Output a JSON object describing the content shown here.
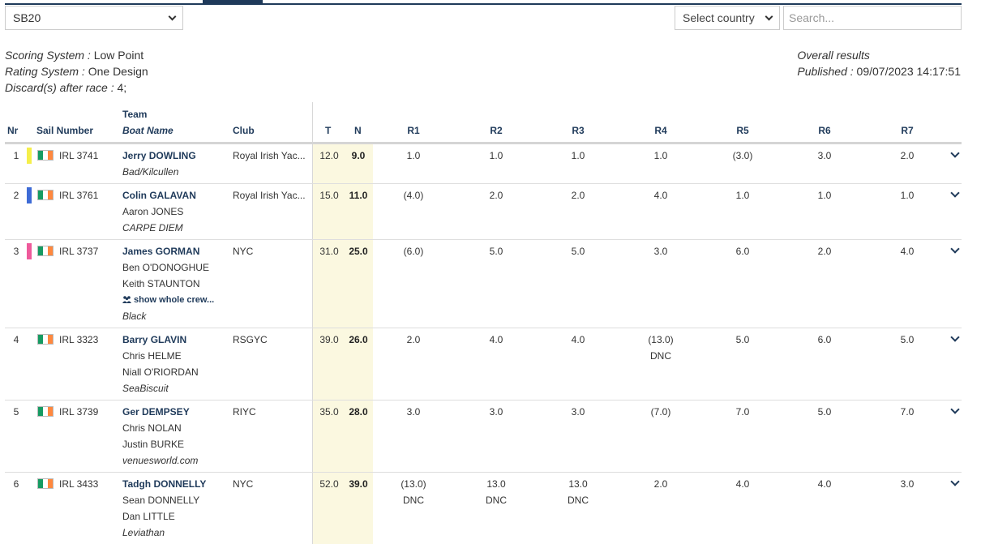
{
  "filters": {
    "class_value": "SB20",
    "country_value": "Select country",
    "search_placeholder": "Search..."
  },
  "meta": {
    "scoring_label": "Scoring System :",
    "scoring_value": " Low Point",
    "rating_label": "Rating System :",
    "rating_value": " One Design",
    "discard_label": "Discard(s) after race :",
    "discard_value": " 4;",
    "results_title": "Overall results",
    "published_label": "Published :",
    "published_value": " 09/07/2023 14:17:51"
  },
  "headers": {
    "nr": "Nr",
    "sail": "Sail Number",
    "team": "Team",
    "boat": "Boat Name",
    "club": "Club",
    "t": "T",
    "n": "N",
    "races": [
      "R1",
      "R2",
      "R3",
      "R4",
      "R5",
      "R6",
      "R7"
    ]
  },
  "colors": {
    "navy": "#1f3a5a",
    "highlight": "#fbf8e0",
    "flag_green": "#169b62",
    "flag_white": "#ffffff",
    "flag_orange": "#ff883e"
  },
  "rows": [
    {
      "nr": "1",
      "tag_color": "#f5ef4a",
      "flag_icon": "ireland-flag-icon",
      "sail": "IRL 3741",
      "skipper": "Jerry DOWLING",
      "crew": [],
      "show_crew": "",
      "boat": "Bad/Kilcullen",
      "club": "Royal Irish Yac...",
      "t": "12.0",
      "n": "9.0",
      "races": [
        [
          "1.0",
          ""
        ],
        [
          "1.0",
          ""
        ],
        [
          "1.0",
          ""
        ],
        [
          "1.0",
          ""
        ],
        [
          "(3.0)",
          ""
        ],
        [
          "3.0",
          ""
        ],
        [
          "2.0",
          ""
        ]
      ]
    },
    {
      "nr": "2",
      "tag_color": "#3e6bd6",
      "flag_icon": "ireland-flag-icon",
      "sail": "IRL 3761",
      "skipper": "Colin GALAVAN",
      "crew": [
        "Aaron JONES"
      ],
      "show_crew": "",
      "boat": "CARPE DIEM",
      "club": "Royal Irish Yac...",
      "t": "15.0",
      "n": "11.0",
      "races": [
        [
          "(4.0)",
          ""
        ],
        [
          "2.0",
          ""
        ],
        [
          "2.0",
          ""
        ],
        [
          "4.0",
          ""
        ],
        [
          "1.0",
          ""
        ],
        [
          "1.0",
          ""
        ],
        [
          "1.0",
          ""
        ]
      ]
    },
    {
      "nr": "3",
      "tag_color": "#ee5a9b",
      "flag_icon": "ireland-flag-icon",
      "sail": "IRL 3737",
      "skipper": "James GORMAN",
      "crew": [
        "Ben O'DONOGHUE",
        "Keith STAUNTON"
      ],
      "show_crew": "show whole crew...",
      "boat": "Black",
      "club": "NYC",
      "t": "31.0",
      "n": "25.0",
      "races": [
        [
          "(6.0)",
          ""
        ],
        [
          "5.0",
          ""
        ],
        [
          "5.0",
          ""
        ],
        [
          "3.0",
          ""
        ],
        [
          "6.0",
          ""
        ],
        [
          "2.0",
          ""
        ],
        [
          "4.0",
          ""
        ]
      ]
    },
    {
      "nr": "4",
      "tag_color": "",
      "flag_icon": "ireland-flag-icon",
      "sail": "IRL 3323",
      "skipper": "Barry GLAVIN",
      "crew": [
        "Chris HELME",
        "Niall O'RIORDAN"
      ],
      "show_crew": "",
      "boat": "SeaBiscuit",
      "club": "RSGYC",
      "t": "39.0",
      "n": "26.0",
      "races": [
        [
          "2.0",
          ""
        ],
        [
          "4.0",
          ""
        ],
        [
          "4.0",
          ""
        ],
        [
          "(13.0)",
          "DNC"
        ],
        [
          "5.0",
          ""
        ],
        [
          "6.0",
          ""
        ],
        [
          "5.0",
          ""
        ]
      ]
    },
    {
      "nr": "5",
      "tag_color": "",
      "flag_icon": "ireland-flag-icon",
      "sail": "IRL 3739",
      "skipper": "Ger DEMPSEY",
      "crew": [
        "Chris NOLAN",
        "Justin BURKE"
      ],
      "show_crew": "",
      "boat": "venuesworld.com",
      "club": "RIYC",
      "t": "35.0",
      "n": "28.0",
      "races": [
        [
          "3.0",
          ""
        ],
        [
          "3.0",
          ""
        ],
        [
          "3.0",
          ""
        ],
        [
          "(7.0)",
          ""
        ],
        [
          "7.0",
          ""
        ],
        [
          "5.0",
          ""
        ],
        [
          "7.0",
          ""
        ]
      ]
    },
    {
      "nr": "6",
      "tag_color": "",
      "flag_icon": "ireland-flag-icon",
      "sail": "IRL 3433",
      "skipper": "Tadgh DONNELLY",
      "crew": [
        "Sean DONNELLY",
        "Dan LITTLE"
      ],
      "show_crew": "",
      "boat": "Leviathan",
      "club": "NYC",
      "t": "52.0",
      "n": "39.0",
      "races": [
        [
          "(13.0)",
          "DNC"
        ],
        [
          "13.0",
          "DNC"
        ],
        [
          "13.0",
          "DNC"
        ],
        [
          "2.0",
          ""
        ],
        [
          "4.0",
          ""
        ],
        [
          "4.0",
          ""
        ],
        [
          "3.0",
          ""
        ]
      ]
    }
  ]
}
